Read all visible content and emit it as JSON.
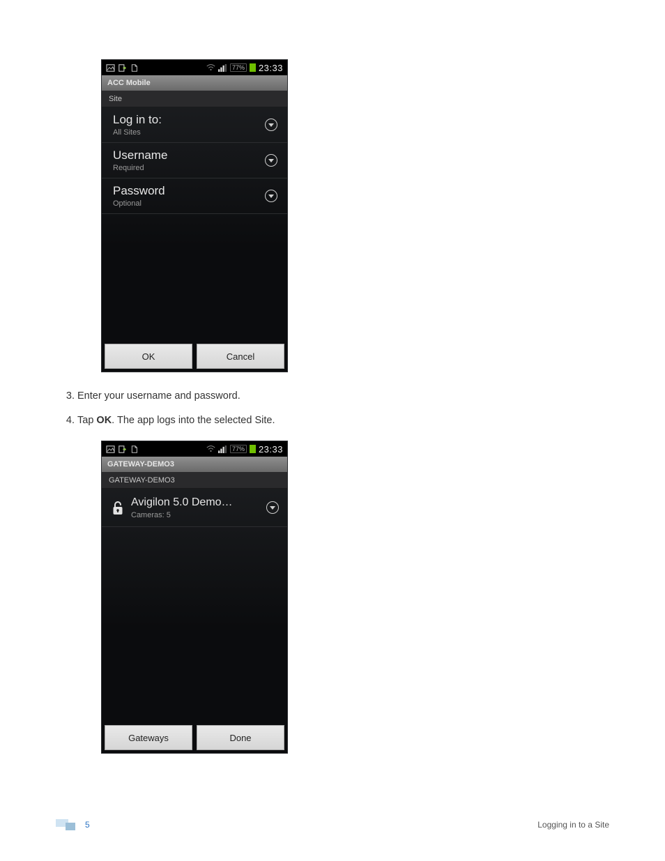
{
  "statusbar": {
    "battery_pct": "77%",
    "clock": "23:33"
  },
  "phone1": {
    "app_title": "ACC Mobile",
    "section": "Site",
    "rows": [
      {
        "title": "Log in to:",
        "sub": "All Sites"
      },
      {
        "title": "Username",
        "sub": "Required"
      },
      {
        "title": "Password",
        "sub": "Optional"
      }
    ],
    "ok": "OK",
    "cancel": "Cancel"
  },
  "steps": {
    "item3": "Enter your username and password.",
    "item4_prefix": "Tap ",
    "item4_bold": "OK",
    "item4_suffix": ". The app logs into the selected Site."
  },
  "phone2": {
    "app_title": "GATEWAY-DEMO3",
    "section": "GATEWAY-DEMO3",
    "site_name": "Avigilon 5.0 Demo…",
    "site_sub": "Cameras: 5",
    "gateways": "Gateways",
    "done": "Done"
  },
  "footer": {
    "page_number": "5",
    "title": "Logging in to a Site"
  }
}
